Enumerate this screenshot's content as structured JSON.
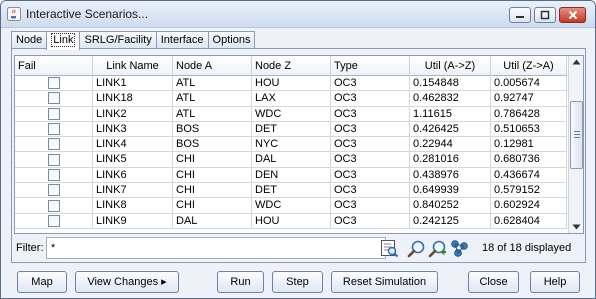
{
  "window": {
    "title": "Interactive Scenarios..."
  },
  "tabs": [
    {
      "label": "Node",
      "active": false
    },
    {
      "label": "Link",
      "active": true
    },
    {
      "label": "SRLG/Facility",
      "active": false
    },
    {
      "label": "Interface",
      "active": false
    },
    {
      "label": "Options",
      "active": false
    }
  ],
  "table": {
    "columns": [
      "Fail",
      "Link Name",
      "Node A",
      "Node Z",
      "Type",
      "Util (A->Z)",
      "Util (Z->A)"
    ],
    "rows": [
      {
        "fail": false,
        "cells": [
          "LINK1",
          "ATL",
          "HOU",
          "OC3",
          "0.154848",
          "0.005674"
        ]
      },
      {
        "fail": false,
        "cells": [
          "LINK18",
          "ATL",
          "LAX",
          "OC3",
          "0.462832",
          "0.92747"
        ]
      },
      {
        "fail": false,
        "cells": [
          "LINK2",
          "ATL",
          "WDC",
          "OC3",
          "1.11615",
          "0.786428"
        ]
      },
      {
        "fail": false,
        "cells": [
          "LINK3",
          "BOS",
          "DET",
          "OC3",
          "0.426425",
          "0.510653"
        ]
      },
      {
        "fail": false,
        "cells": [
          "LINK4",
          "BOS",
          "NYC",
          "OC3",
          "0.22944",
          "0.12981"
        ]
      },
      {
        "fail": false,
        "cells": [
          "LINK5",
          "CHI",
          "DAL",
          "OC3",
          "0.281016",
          "0.680736"
        ]
      },
      {
        "fail": false,
        "cells": [
          "LINK6",
          "CHI",
          "DEN",
          "OC3",
          "0.438976",
          "0.436674"
        ]
      },
      {
        "fail": false,
        "cells": [
          "LINK7",
          "CHI",
          "DET",
          "OC3",
          "0.649939",
          "0.579152"
        ]
      },
      {
        "fail": false,
        "cells": [
          "LINK8",
          "CHI",
          "WDC",
          "OC3",
          "0.840252",
          "0.602924"
        ]
      },
      {
        "fail": false,
        "cells": [
          "LINK9",
          "DAL",
          "HOU",
          "OC3",
          "0.242125",
          "0.628404"
        ]
      }
    ]
  },
  "filter": {
    "label": "Filter:",
    "value": "*",
    "displayed_text": "18 of 18 displayed"
  },
  "buttons": {
    "map": "Map",
    "view_changes": "View Changes ▸",
    "run": "Run",
    "step": "Step",
    "reset": "Reset Simulation",
    "close": "Close",
    "help": "Help"
  }
}
